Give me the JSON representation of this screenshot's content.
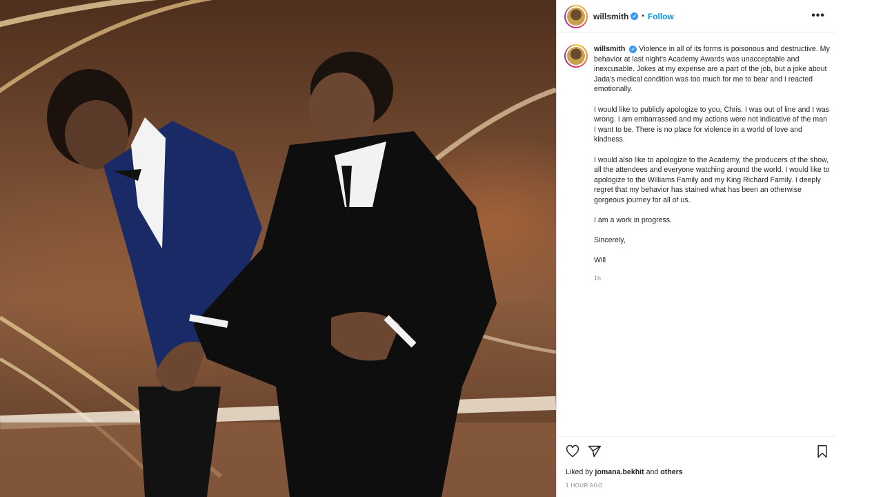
{
  "post": {
    "username": "willsmith",
    "follow_label": "Follow",
    "separator": "•",
    "more_label": "•••"
  },
  "caption": {
    "username": "willsmith",
    "paragraphs": [
      "Violence in all of its forms is poisonous and destructive. My behavior at last night's Academy Awards was unacceptable and inexcusable. Jokes at my expense are a part of the job, but a joke about Jada's medical condition was too much for me to bear and I reacted emotionally.",
      "I would like to publicly apologize to you, Chris. I was out of line and I was wrong. I am embarrassed and my actions were not indicative of the man I want to be. There is no place for violence in a world of love and kindness.",
      "I would also like to apologize to the Academy, the producers of the show, all the attendees and everyone watching around the world. I would like to apologize to the Williams Family and my King Richard Family. I deeply regret that my behavior has stained what has been an otherwise gorgeous journey for all of us.",
      "I am a work in progress.",
      "Sincerely,",
      "Will"
    ],
    "time": "1h"
  },
  "footer": {
    "liked_prefix": "Liked by",
    "liked_user": "jomana.bekhit",
    "liked_and": "and",
    "liked_others": "others",
    "timestamp": "1 HOUR AGO"
  },
  "icons": {
    "like": "heart-icon",
    "share": "send-icon",
    "save": "bookmark-icon",
    "verified": "verified-badge-icon"
  },
  "colors": {
    "follow": "#0095f6",
    "verified": "#3897f0",
    "muted": "#8e8e8e"
  }
}
